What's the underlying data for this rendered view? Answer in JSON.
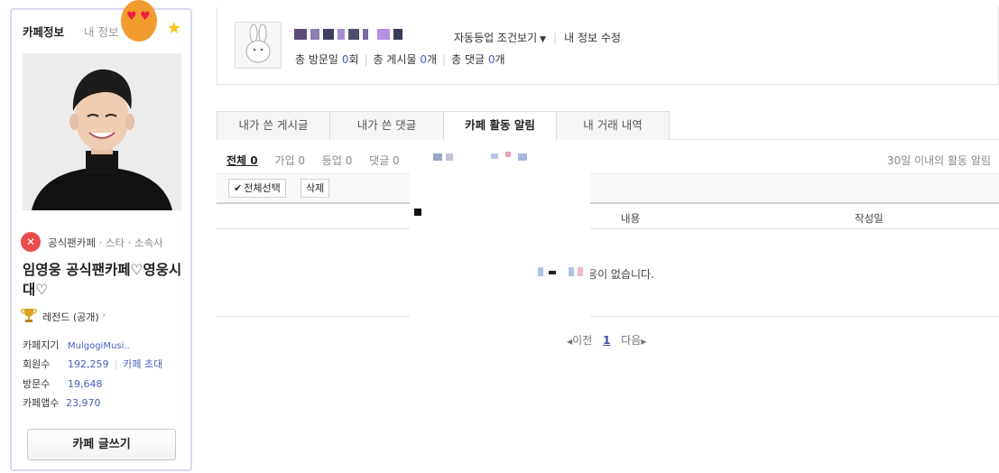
{
  "sidebar": {
    "tab_cafe_info": "카페정보",
    "tab_my_info": "내 정보",
    "cafe_type": "공식팬카페",
    "cafe_category": "· 스타 · 소속사",
    "cafe_name": "임영웅 공식팬카페♡영웅시대♡",
    "grade": "레전드 (공개)",
    "stats": {
      "manager_label": "카페지기",
      "manager_value": "MulgogiMusi..",
      "members_label": "회원수",
      "members_value": "192,259",
      "invite_label": "카페 초대",
      "visits_label": "방문수",
      "visits_value": "19,648",
      "app_users_label": "카페앱수",
      "app_users_value": "23,970"
    },
    "write_button": "카페 글쓰기"
  },
  "member": {
    "auto_rank_link": "자동등업 조건보기",
    "my_info_edit": "내 정보 수정",
    "visit_label": "총 방문일",
    "visit_count": "0",
    "visit_unit": "회",
    "posts_label": "총 게시물",
    "posts_count": "0",
    "posts_unit": "개",
    "comments_label": "총 댓글",
    "comments_count": "0",
    "comments_unit": "개"
  },
  "tabs": [
    {
      "label": "내가 쓴 게시글",
      "active": false
    },
    {
      "label": "내가 쓴 댓글",
      "active": false
    },
    {
      "label": "카페 활동 알림",
      "active": true
    },
    {
      "label": "내 거래 내역",
      "active": false
    }
  ],
  "filters": [
    {
      "label": "전체 0",
      "active": true
    },
    {
      "label": "가입 0",
      "active": false
    },
    {
      "label": "등업 0",
      "active": false
    },
    {
      "label": "댓글 0",
      "active": false
    }
  ],
  "filter_note": "30일 이내의 활동 알림",
  "actions": {
    "select_all": "전체선택",
    "delete": "삭제"
  },
  "table": {
    "col_content": "내용",
    "col_date": "작성일",
    "empty_message": "반응이 없습니다."
  },
  "pagination": {
    "prev": "이전",
    "current": "1",
    "next": "다음"
  },
  "colors": {
    "accent_blue": "#4a5fb8",
    "panel_border": "#dcd6f0",
    "star": "#f5c518",
    "cafe_type_icon": "#e84c4c"
  },
  "icons": {
    "star": "star-icon",
    "trophy": "trophy-icon",
    "check": "check-icon",
    "caret": "caret-down-icon",
    "official": "official-cafe-icon"
  }
}
